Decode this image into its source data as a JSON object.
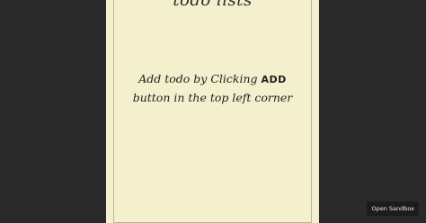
{
  "page": {
    "title": "todo lists",
    "hint": {
      "before": "Add todo by Clicking ",
      "keyword": "ADD",
      "after": " button in the top left corner"
    }
  },
  "sandbox": {
    "label": "Open Sandbox"
  },
  "colors": {
    "background": "#2a2a2a",
    "paper": "#f4efcc",
    "text": "#1f1f1f"
  }
}
